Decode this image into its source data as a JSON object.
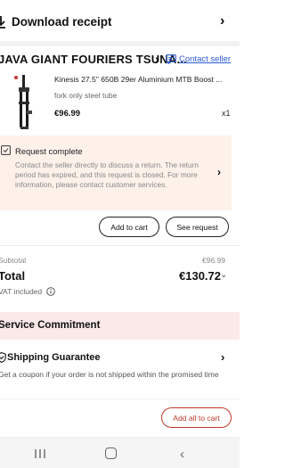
{
  "header": {
    "title": "Download receipt"
  },
  "store": {
    "name": "JAVA GIANT FOURIERS TSUNA...",
    "contact_label": "Contact seller"
  },
  "product": {
    "title": "Kinesis 27.5\" 650B 29er Aluminium MTB Boost ...",
    "variant": "fork only steel tube",
    "price": "€96.99",
    "quantity": "x1"
  },
  "request": {
    "title": "Request complete",
    "text": "Contact the seller directly to discuss a return. The return period has expired, and this request is closed. For more information, please contact customer services."
  },
  "actions": {
    "add_to_cart": "Add to cart",
    "see_request": "See request"
  },
  "summary": {
    "subtotal_label": "Subtotal",
    "subtotal_value": "€96.99",
    "total_label": "Total",
    "total_value": "€130.72",
    "vat_label": "VAT included"
  },
  "service": {
    "title": "Service Commitment",
    "shipping_title": "Shipping Guarantee",
    "shipping_desc": "Get a coupon if your order is not shipped within the promised time"
  },
  "footer": {
    "add_all_to_cart": "Add all to cart"
  },
  "colors": {
    "accent_red": "#c0392b",
    "link_blue": "#2a5cd6",
    "request_bg": "#fdf1ea",
    "service_bg": "#fbe9e9"
  }
}
